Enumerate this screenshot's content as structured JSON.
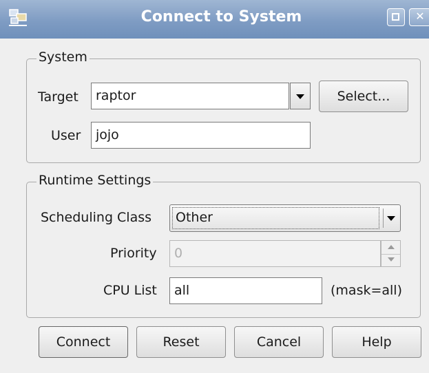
{
  "window": {
    "title": "Connect to System",
    "icon": "network-connect-icon",
    "controls": [
      "maximize-icon",
      "close-icon"
    ]
  },
  "system": {
    "legend": "System",
    "target_label": "Target",
    "target_value": "raptor",
    "select_button": "Select...",
    "user_label": "User",
    "user_value": "jojo"
  },
  "runtime": {
    "legend": "Runtime Settings",
    "scheduling_label": "Scheduling Class",
    "scheduling_value": "Other",
    "priority_label": "Priority",
    "priority_value": "0",
    "cpu_label": "CPU List",
    "cpu_value": "all",
    "cpu_mask_note": "(mask=all)"
  },
  "buttons": {
    "connect": "Connect",
    "reset": "Reset",
    "cancel": "Cancel",
    "help": "Help"
  },
  "colors": {
    "titlebar": "#7f9cc3",
    "window_bg": "#efefef"
  }
}
